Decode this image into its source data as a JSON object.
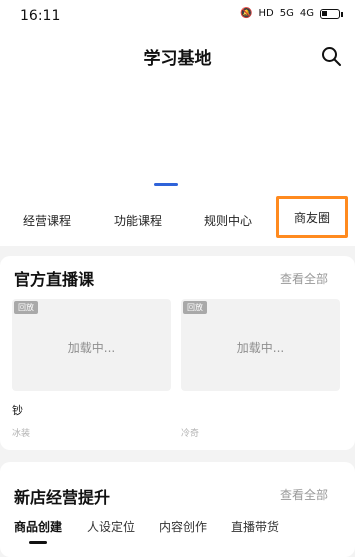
{
  "status_bar": {
    "time": "16:11",
    "icons": [
      "silent-icon",
      "hd-icon",
      "signal-5g-icon",
      "signal-4g-icon",
      "battery-icon"
    ],
    "hd_label": "HD",
    "network_1": "5G",
    "network_2": "4G"
  },
  "header": {
    "title": "学习基地"
  },
  "nav": {
    "items": [
      {
        "label": "经营课程"
      },
      {
        "label": "功能课程"
      },
      {
        "label": "规则中心"
      },
      {
        "label": "商友圈"
      }
    ],
    "highlight_color": "#ff8a1f"
  },
  "live_section": {
    "title": "官方直播课",
    "more": "查看全部",
    "tiles": [
      {
        "badge": "回放",
        "loading": "加载中...",
        "title": "钞",
        "sub": "冰装"
      },
      {
        "badge": "回放",
        "loading": "加载中...",
        "title": "",
        "sub": "冷奇"
      }
    ]
  },
  "new_store_section": {
    "title": "新店经营提升",
    "more": "查看全部",
    "tabs": [
      {
        "label": "商品创建"
      },
      {
        "label": "人设定位"
      },
      {
        "label": "内容创作"
      },
      {
        "label": "直播带货"
      }
    ]
  },
  "colors": {
    "accent": "#2f63d9",
    "text_primary": "#111111",
    "text_muted": "#999999",
    "background": "#f3f3f3"
  }
}
